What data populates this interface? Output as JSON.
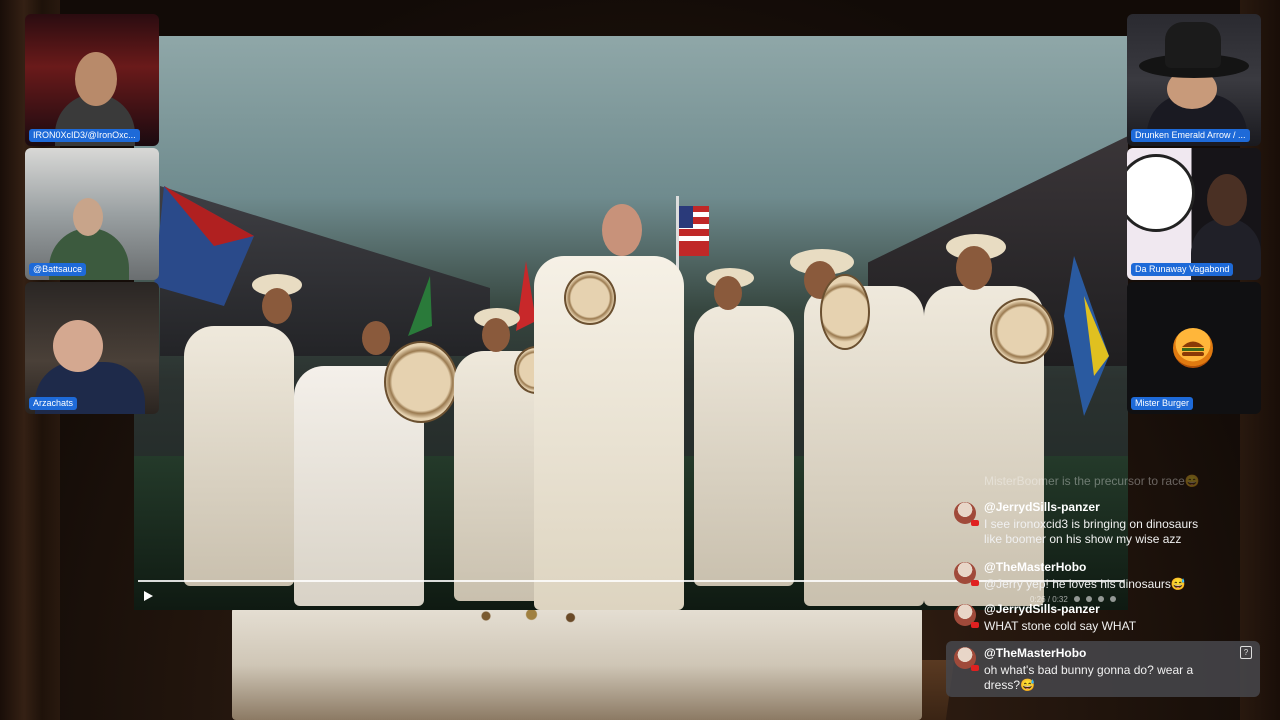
{
  "participants": [
    {
      "id": "cam-1",
      "label": "IRON0XcID3/@IronOxc..."
    },
    {
      "id": "cam-2",
      "label": "@Battsauce"
    },
    {
      "id": "cam-3",
      "label": "Arzachats"
    },
    {
      "id": "cam-4",
      "label": "Drunken Emerald Arrow / ..."
    },
    {
      "id": "cam-5",
      "label": "Da Runaway Vagabond"
    },
    {
      "id": "cam-6",
      "label": "Mister Burger"
    }
  ],
  "video": {
    "time": "0:26 / 0:32",
    "progress": 0.81,
    "icons": [
      "play-icon",
      "volume-icon",
      "settings-icon",
      "pip-icon",
      "fullscreen-icon"
    ]
  },
  "chat": {
    "faded_message": "MisterBoomer is the precursor to race😄",
    "messages": [
      {
        "author": "@JerrydSills-panzer",
        "text": "I see ironoxcid3 is bringing on dinosaurs like boomer on his show my wise azz"
      },
      {
        "author": "@TheMasterHobo",
        "text": "@Jerry yep! he loves his dinosaurs😅"
      },
      {
        "author": "@JerrydSills-panzer",
        "text": "WHAT stone cold say WHAT"
      },
      {
        "author": "@TheMasterHobo",
        "text": "oh what's bad bunny gonna do? wear a dress?😅"
      }
    ]
  },
  "colors": {
    "label_bg": "#1e6ad8",
    "highlight_msg_bg": "#46464a"
  }
}
